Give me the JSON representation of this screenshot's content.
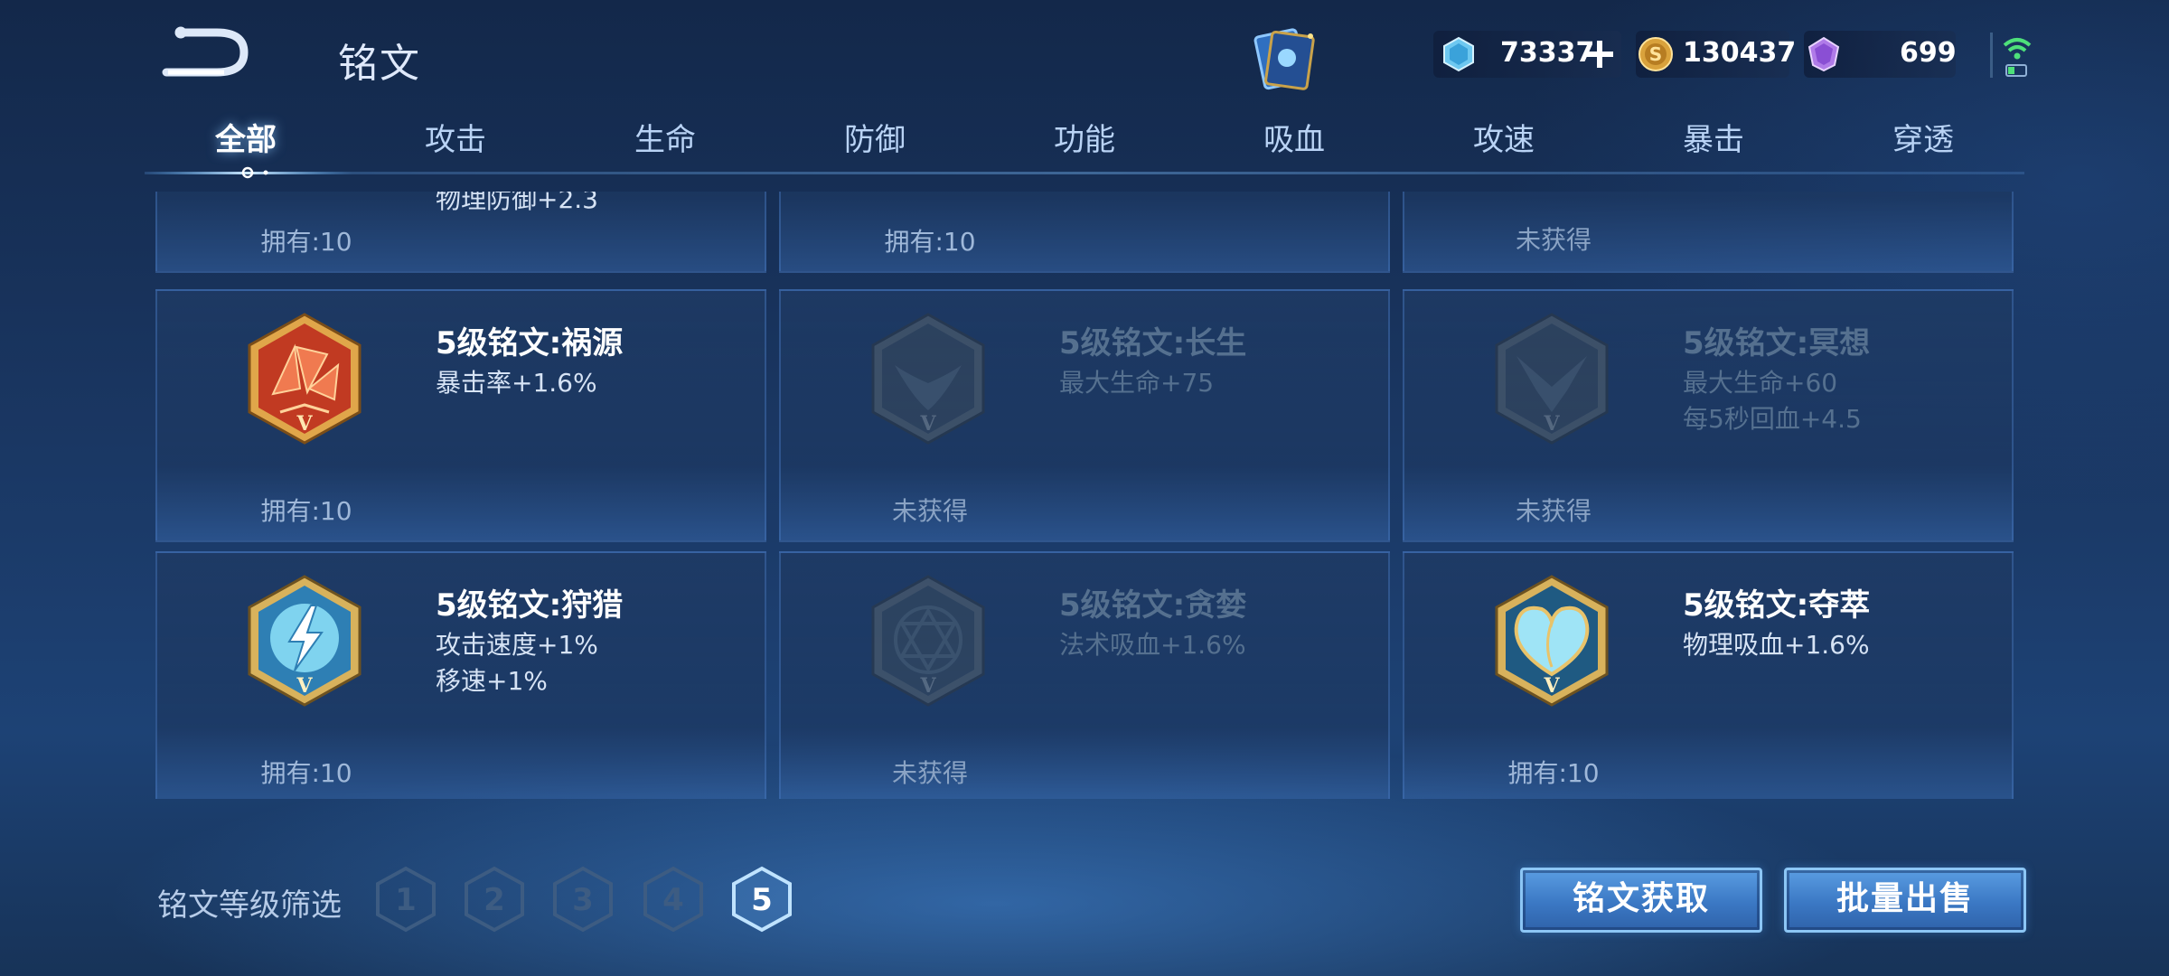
{
  "header": {
    "title": "铭文",
    "back_icon": "back-arrow-icon",
    "card_icon": "inscription-book-icon"
  },
  "currencies": [
    {
      "icon": "gem-icon",
      "amount": "73337",
      "has_plus": true
    },
    {
      "icon": "gold-coin-icon",
      "amount": "130437",
      "has_plus": false
    },
    {
      "icon": "diamond-icon",
      "amount": "699",
      "has_plus": false
    }
  ],
  "tabs": [
    {
      "label": "全部",
      "active": true
    },
    {
      "label": "攻击",
      "active": false
    },
    {
      "label": "生命",
      "active": false
    },
    {
      "label": "防御",
      "active": false
    },
    {
      "label": "功能",
      "active": false
    },
    {
      "label": "吸血",
      "active": false
    },
    {
      "label": "攻速",
      "active": false
    },
    {
      "label": "暴击",
      "active": false
    },
    {
      "label": "穿透",
      "active": false
    }
  ],
  "partial_row": [
    {
      "stat": "物理防御+2.3",
      "count": "拥有:10"
    },
    {
      "count": "拥有:10"
    },
    {
      "count": "未获得"
    }
  ],
  "cards": [
    {
      "name": "5级铭文:祸源",
      "stats": [
        "暴击率+1.6%"
      ],
      "count": "拥有:10",
      "locked": false,
      "badge": "red-shards-badge-icon",
      "color": "#d44a2c"
    },
    {
      "name": "5级铭文:长生",
      "stats": [
        "最大生命+75"
      ],
      "count": "未获得",
      "locked": true,
      "badge": "wing-badge-icon",
      "color": "#3d6d8a"
    },
    {
      "name": "5级铭文:冥想",
      "stats": [
        "最大生命+60",
        "每5秒回血+4.5"
      ],
      "count": "未获得",
      "locked": true,
      "badge": "bird-badge-icon",
      "color": "#3d6d8a"
    },
    {
      "name": "5级铭文:狩猎",
      "stats": [
        "攻击速度+1%",
        "移速+1%"
      ],
      "count": "拥有:10",
      "locked": false,
      "badge": "lightning-badge-icon",
      "color": "#5fc3e4"
    },
    {
      "name": "5级铭文:贪婪",
      "stats": [
        "法术吸血+1.6%"
      ],
      "count": "未获得",
      "locked": true,
      "badge": "star-badge-icon",
      "color": "#3d6d8a"
    },
    {
      "name": "5级铭文:夺萃",
      "stats": [
        "物理吸血+1.6%"
      ],
      "count": "拥有:10",
      "locked": false,
      "badge": "heart-badge-icon",
      "color": "#7fd6ee"
    }
  ],
  "footer": {
    "filter_label": "铭文等级筛选",
    "levels": [
      "1",
      "2",
      "3",
      "4",
      "5"
    ],
    "selected_level": "5",
    "obtain_button": "铭文获取",
    "sell_button": "批量出售"
  },
  "colors": {
    "accent": "#5a9de2",
    "badge_gold": "#c9a24a",
    "level_inactive": "#3d5c82",
    "level_active": "#bfe3ff"
  }
}
